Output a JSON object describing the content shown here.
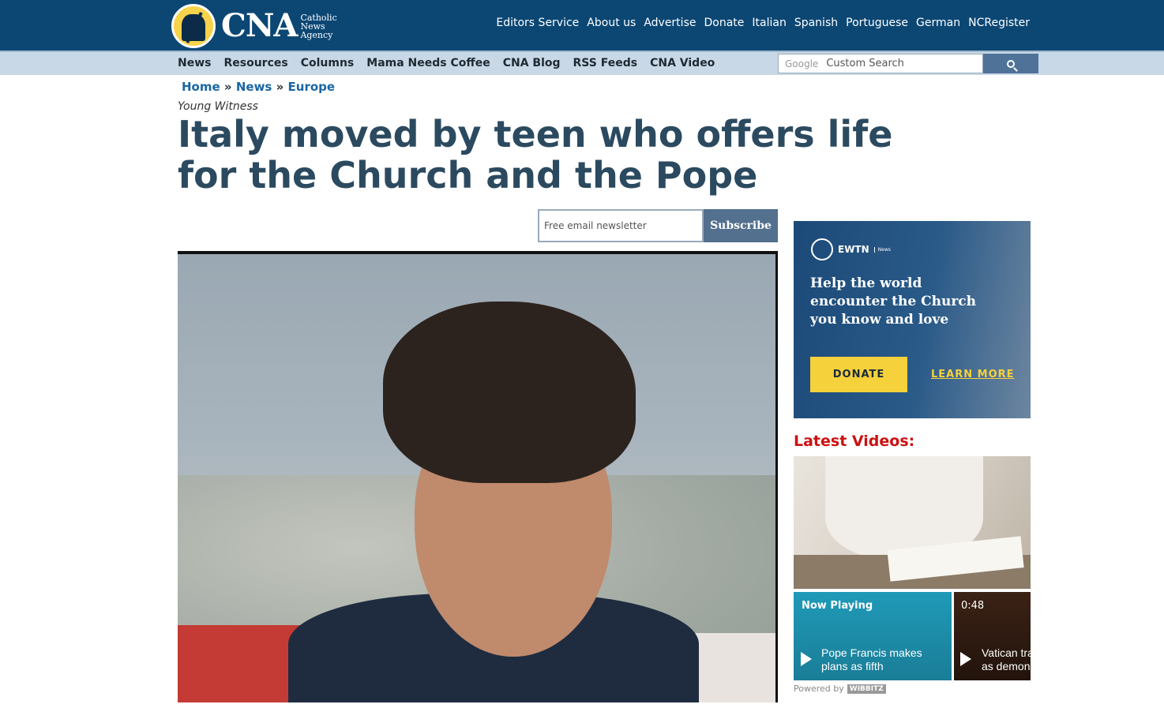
{
  "header": {
    "logo_text": "CNA",
    "logo_sub": [
      "Catholic",
      "News",
      "Agency"
    ],
    "nav": [
      "Editors Service",
      "About us",
      "Advertise",
      "Donate",
      "Italian",
      "Spanish",
      "Portuguese",
      "German",
      "NCRegister"
    ]
  },
  "subnav": {
    "items": [
      "News",
      "Resources",
      "Columns",
      "Mama Needs Coffee",
      "CNA Blog",
      "RSS Feeds",
      "CNA Video"
    ],
    "search_brand": "Google",
    "search_placeholder": "Custom Search"
  },
  "breadcrumb": {
    "items": [
      "Home",
      "News",
      "Europe"
    ],
    "separator": "»"
  },
  "article": {
    "kicker": "Young Witness",
    "headline": "Italy moved by teen who offers life for the Church and the Pope"
  },
  "newsletter": {
    "placeholder": "Free email newsletter",
    "button": "Subscribe"
  },
  "ad": {
    "brand": "EWTN",
    "brand_sub": "News",
    "text": "Help the world encounter the Church you know and love",
    "donate": "DONATE",
    "learn_more": "LEARN MORE",
    "accent_color": "#f5d13b"
  },
  "videos": {
    "title": "Latest Videos:",
    "cards": [
      {
        "label": "Now Playing",
        "title_line1": "Pope Francis makes",
        "title_line2": "plans as fifth"
      },
      {
        "label": "0:48",
        "title_line1": "Vatican tra",
        "title_line2": "as demon"
      }
    ],
    "powered_by": "Powered by",
    "powered_brand": "WIBBITZ"
  },
  "colors": {
    "header_bg": "#0c4774",
    "subnav_bg": "#c8d8e6",
    "headline": "#2b4a60",
    "link": "#1a66a3",
    "videos_title": "#cc1111"
  }
}
